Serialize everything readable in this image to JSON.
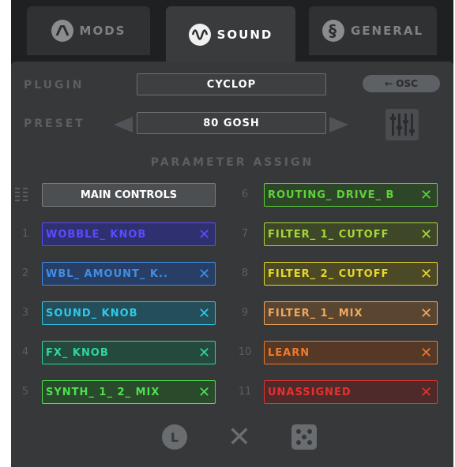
{
  "tabs": [
    {
      "label": "MODS",
      "icon": "waveform-arc-icon",
      "active": false
    },
    {
      "label": "SOUND",
      "icon": "sine-wave-icon",
      "active": true
    },
    {
      "label": "GENERAL",
      "icon": "section-icon",
      "active": false
    }
  ],
  "plugin": {
    "label": "PLUGIN",
    "value": "CYCLOP",
    "osc_button": "← OSC"
  },
  "preset": {
    "label": "PRESET",
    "value": "80 GOSH"
  },
  "parameter_assign": {
    "heading": "PARAMETER ASSIGN",
    "main_controls": "MAIN CONTROLS",
    "left": [
      {
        "num": "1",
        "label": "WOBBLE_ KNOB",
        "color": "#5b4bff",
        "bg": "#2f3070"
      },
      {
        "num": "2",
        "label": "WBL_ AMOUNT_ K..",
        "color": "#3f8ee8",
        "bg": "#283e64"
      },
      {
        "num": "3",
        "label": "SOUND_ KNOB",
        "color": "#2fc9e8",
        "bg": "#234e5a"
      },
      {
        "num": "4",
        "label": "FX_ KNOB",
        "color": "#2fd6a0",
        "bg": "#244a3e"
      },
      {
        "num": "5",
        "label": "SYNTH_ 1_ 2_ MIX",
        "color": "#4ee04e",
        "bg": "#2a4a2c"
      }
    ],
    "right": [
      {
        "num": "6",
        "label": "ROUTING_ DRIVE_ B",
        "color": "#5ed23a",
        "bg": "#2e4628"
      },
      {
        "num": "7",
        "label": "FILTER_ 1_ CUTOFF",
        "color": "#a8d63a",
        "bg": "#3e4828"
      },
      {
        "num": "8",
        "label": "FILTER_ 2_ CUTOFF",
        "color": "#e8d82a",
        "bg": "#4c4a26"
      },
      {
        "num": "9",
        "label": "FILTER_ 1_ MIX",
        "color": "#f0a860",
        "bg": "#5a4630"
      },
      {
        "num": "10",
        "label": "LEARN",
        "color": "#f07a2a",
        "bg": "#553826"
      },
      {
        "num": "11",
        "label": "UNASSIGNED",
        "color": "#e83030",
        "bg": "#4e2a2a"
      }
    ],
    "remove_symbol": "✕"
  },
  "bottom": {
    "lock_label": "L",
    "clear_symbol": "✕"
  }
}
